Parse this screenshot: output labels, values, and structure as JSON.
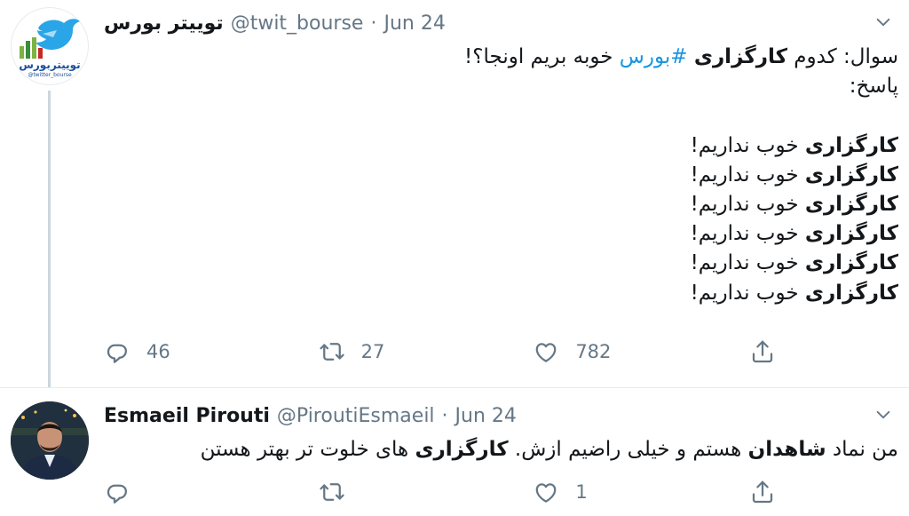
{
  "tweets": [
    {
      "display_name": "توییتر بورس",
      "handle": "@twit_bourse",
      "separator": "·",
      "date": "Jun 24",
      "avatar_label": "توییتربورس",
      "avatar_handle": "@twitter_bourse",
      "body": {
        "line1_prefix": "سوال: کدوم ",
        "line1_bold": "کارگزاری",
        "line1_space": " ",
        "line1_hashtag": "#بورس",
        "line1_suffix": " خوبه بریم اونجا؟!",
        "line2": "پاسخ:",
        "repeat_bold": "کارگزاری",
        "repeat_text": " خوب نداریم!"
      },
      "counts": {
        "reply": "46",
        "retweet": "27",
        "like": "782"
      }
    },
    {
      "display_name": "Esmaeil Pirouti",
      "handle": "@PiroutiEsmaeil",
      "separator": "·",
      "date": "Jun 24",
      "body": {
        "part1": "من نماد ",
        "bold1": "شاهدان",
        "part2": " هستم و خیلی راضیم ازش. ",
        "bold2": "کارگزاری",
        "part3": " های خلوت تر بهتر هستن"
      },
      "counts": {
        "reply": "",
        "retweet": "",
        "like": "1"
      }
    }
  ],
  "icons": {
    "reply": "reply-icon",
    "retweet": "retweet-icon",
    "like": "heart-icon",
    "share": "share-icon",
    "caret": "chevron-down-icon"
  },
  "colors": {
    "text": "#14171a",
    "muted": "#657786",
    "link": "#1b95e0",
    "border": "#e6ecf0"
  }
}
